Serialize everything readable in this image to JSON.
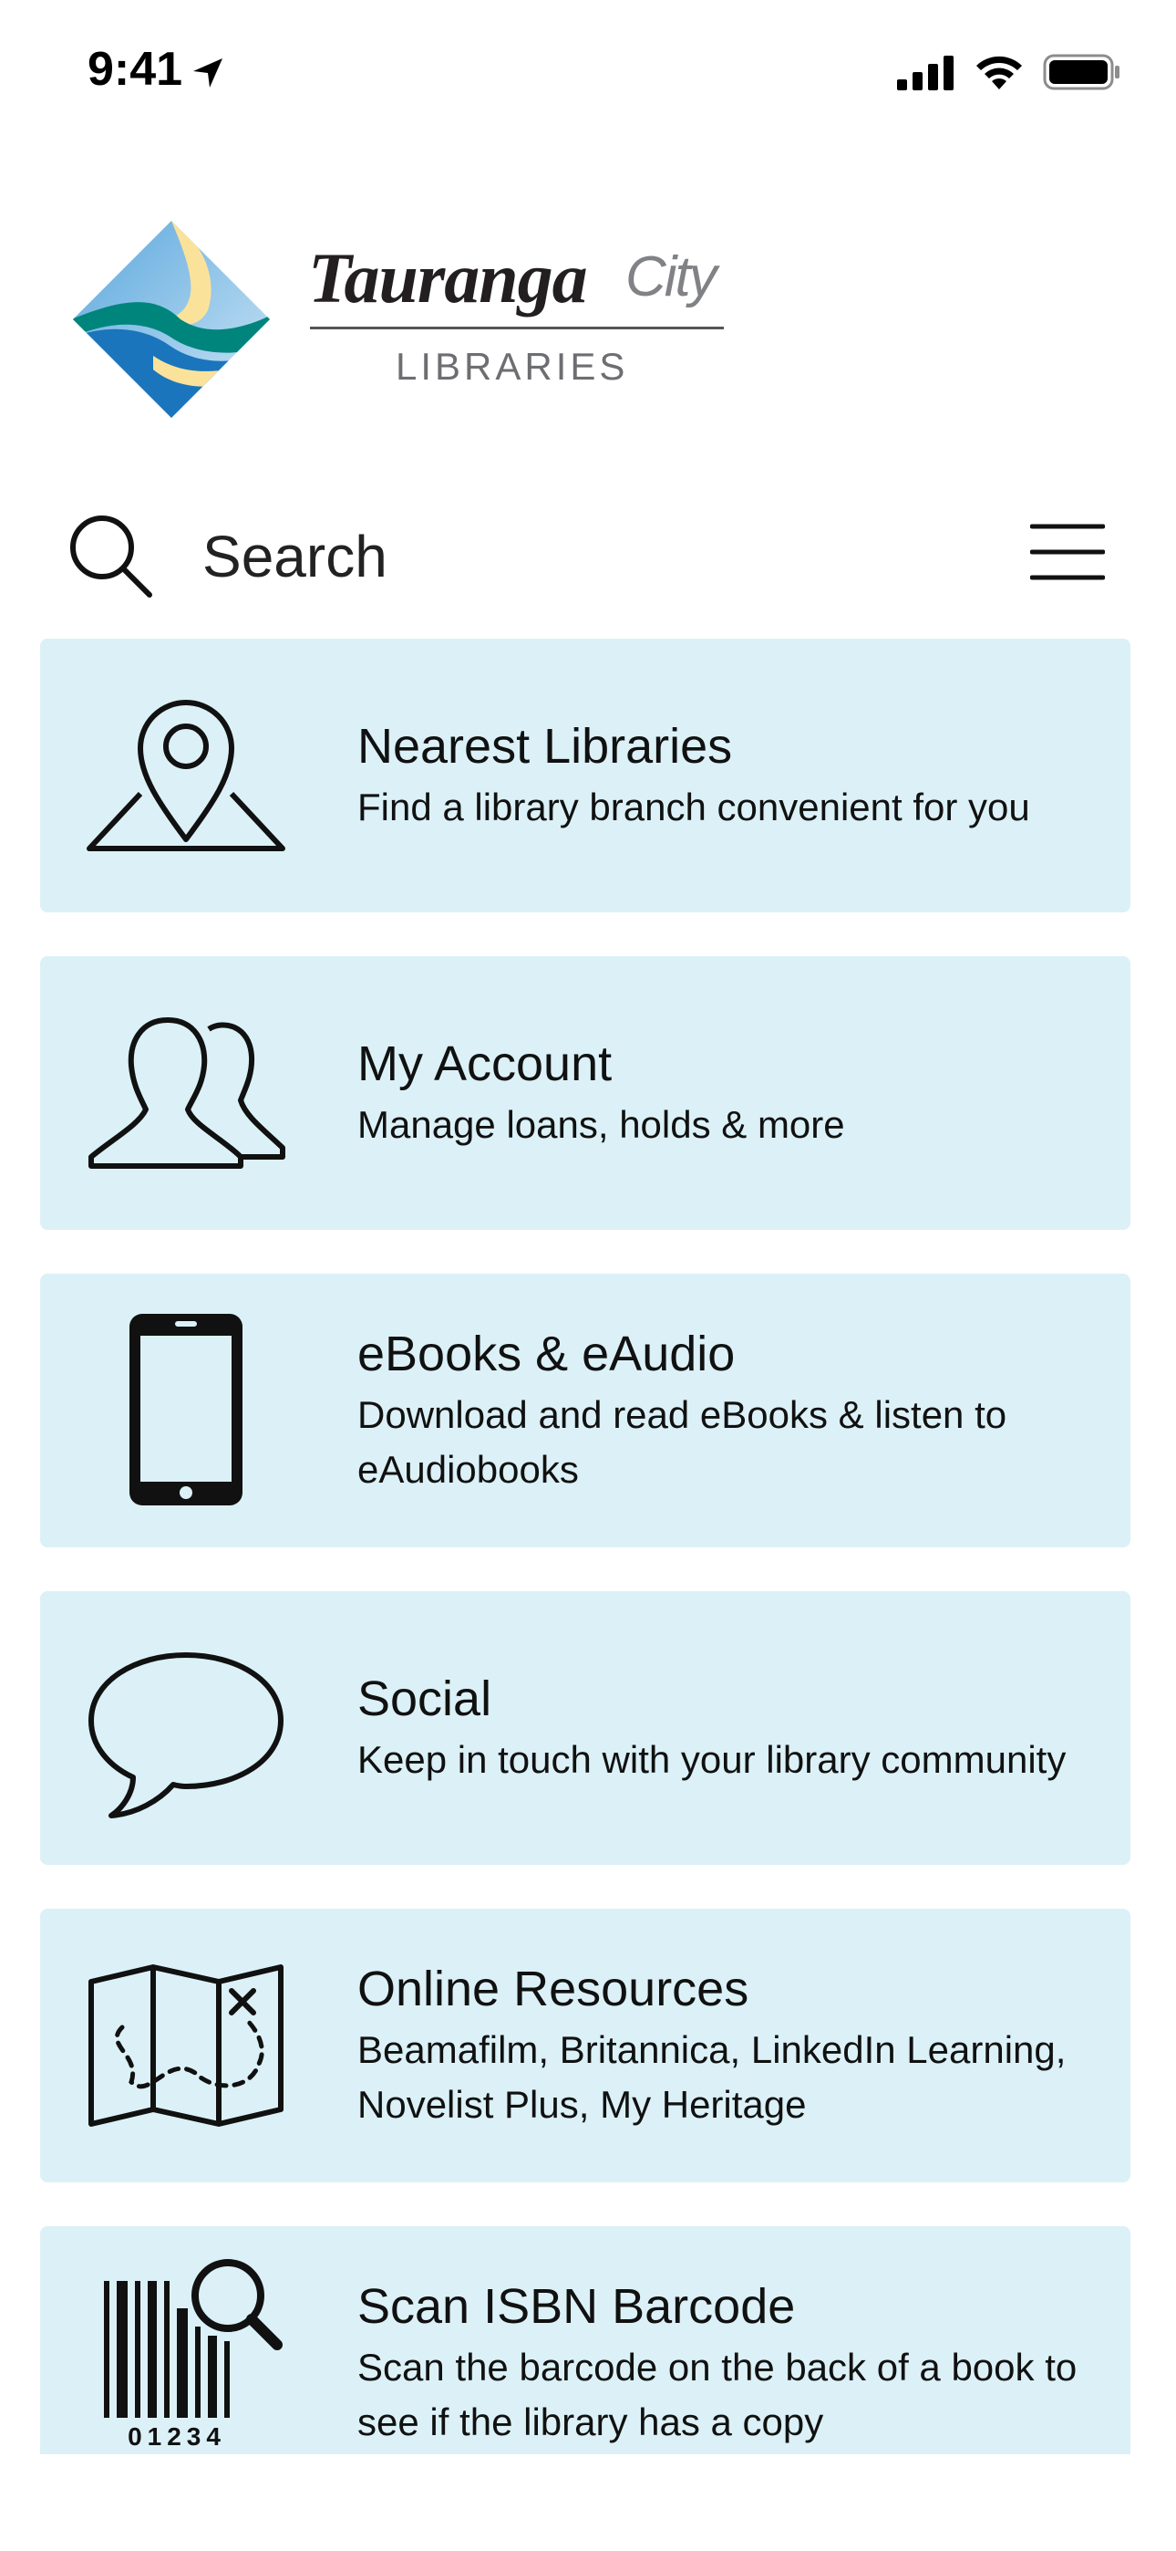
{
  "status": {
    "time": "9:41"
  },
  "logo": {
    "line1": "Tauranga",
    "line2": "City",
    "line3": "LIBRARIES"
  },
  "search": {
    "placeholder": "Search"
  },
  "cards": [
    {
      "title": "Nearest Libraries",
      "subtitle": "Find a library branch convenient for you",
      "icon": "map-pin-icon"
    },
    {
      "title": "My Account",
      "subtitle": "Manage loans, holds & more",
      "icon": "users-icon"
    },
    {
      "title": "eBooks & eAudio",
      "subtitle": "Download and read eBooks & listen to eAudiobooks",
      "icon": "phone-icon"
    },
    {
      "title": "Social",
      "subtitle": "Keep in touch with your library community",
      "icon": "speech-bubble-icon"
    },
    {
      "title": "Online Resources",
      "subtitle": "Beamafilm, Britannica, LinkedIn Learning, Novelist Plus, My Heritage",
      "icon": "treasure-map-icon"
    },
    {
      "title": "Scan ISBN Barcode",
      "subtitle": "Scan the barcode on the back of a book to see if the library has a copy",
      "icon": "barcode-scan-icon",
      "barcode_digits": "01234"
    }
  ],
  "colors": {
    "card_bg": "#dbf1f7",
    "logo_blue": "#1b75bc",
    "logo_yellow": "#fbe29b",
    "logo_teal": "#00857c"
  }
}
